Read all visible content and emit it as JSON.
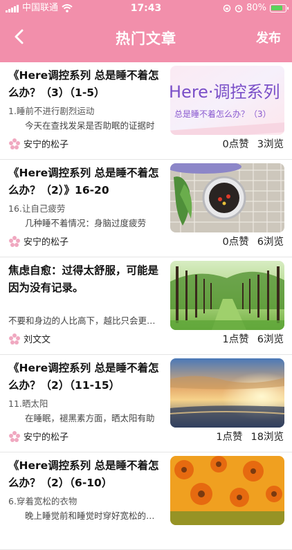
{
  "status": {
    "carrier": "中国联通",
    "time": "17:43",
    "battery": "80%"
  },
  "nav": {
    "title": "热门文章",
    "publish": "发布"
  },
  "articles": [
    {
      "title": "《Here调控系列 总是睡不着怎么办？（3）（1-5）",
      "subtitle": "1.睡前不进行剧烈运动",
      "excerpt": "今天在查找发呆是否助眠的证据时",
      "author": "安宁的松子",
      "likes": "0点赞",
      "views": "3浏览",
      "thumb": {
        "line1": "Here·调控系列",
        "line2": "总是睡不着怎么办？（3）"
      }
    },
    {
      "title": "《Here调控系列 总是睡不着怎么办？（2）》16-20",
      "subtitle": "16.让自己疲劳",
      "excerpt": "几种睡不着情况：身脑过度疲劳",
      "author": "安宁的松子",
      "likes": "0点赞",
      "views": "6浏览"
    },
    {
      "title": "焦虑自愈：过得太舒服，可能是因为没有记录。",
      "subtitle": "",
      "excerpt": "不要和身边的人比高下，越比只会更焦虑",
      "author": "刘文文",
      "likes": "1点赞",
      "views": "6浏览"
    },
    {
      "title": "《Here调控系列 总是睡不着怎么办？（2）（11-15）",
      "subtitle": "11.晒太阳",
      "excerpt": "在睡眠，褪黑素方面，晒太阳有助",
      "author": "安宁的松子",
      "likes": "1点赞",
      "views": "18浏览"
    },
    {
      "title": "《Here调控系列 总是睡不着怎么办？（2）（6-10）",
      "subtitle": "6.穿着宽松的衣物",
      "excerpt": "晚上睡觉前和睡觉时穿好宽松的衣物",
      "author": "",
      "likes": "",
      "views": ""
    }
  ],
  "colors": {
    "header": "#f28fab"
  }
}
